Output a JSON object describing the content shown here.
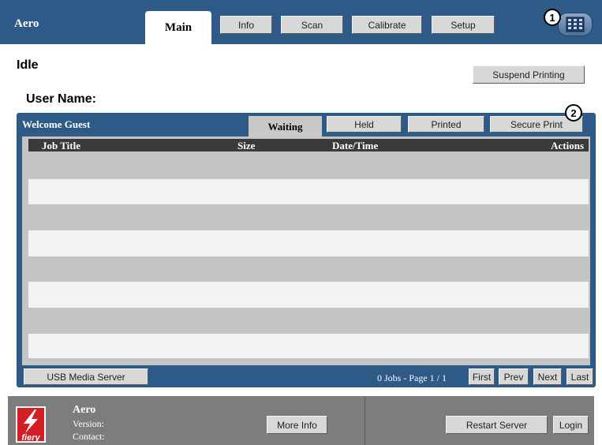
{
  "header": {
    "brand": "Aero",
    "tabs": {
      "main": "Main"
    },
    "nav_buttons": {
      "info": "Info",
      "scan": "Scan",
      "calibrate": "Calibrate",
      "setup": "Setup"
    },
    "monitor_icon": "printer-panel-icon",
    "callout_1": "1"
  },
  "status": {
    "state": "Idle",
    "user_name_label": "User Name:",
    "suspend_label": "Suspend Printing"
  },
  "jobs_panel": {
    "welcome": "Welcome Guest",
    "tabs": {
      "waiting": "Waiting",
      "held": "Held",
      "printed": "Printed",
      "secure": "Secure Print"
    },
    "callout_2": "2",
    "columns": {
      "title": "Job Title",
      "size": "Size",
      "date": "Date/Time",
      "actions": "Actions"
    },
    "usb_label": "USB Media Server",
    "page_info": "0 Jobs - Page 1 / 1",
    "pager": {
      "first": "First",
      "prev": "Prev",
      "next": "Next",
      "last": "Last"
    }
  },
  "footer": {
    "logo_text": "fiery",
    "name": "Aero",
    "version_label": "Version:",
    "contact_label": "Contact:",
    "more_info": "More Info",
    "restart": "Restart Server",
    "login": "Login"
  },
  "colors": {
    "nav_blue": "#2d5a87",
    "button_grey": "#d8d8d8",
    "footer_grey": "#7d7d7d",
    "logo_red": "#d21f26"
  }
}
